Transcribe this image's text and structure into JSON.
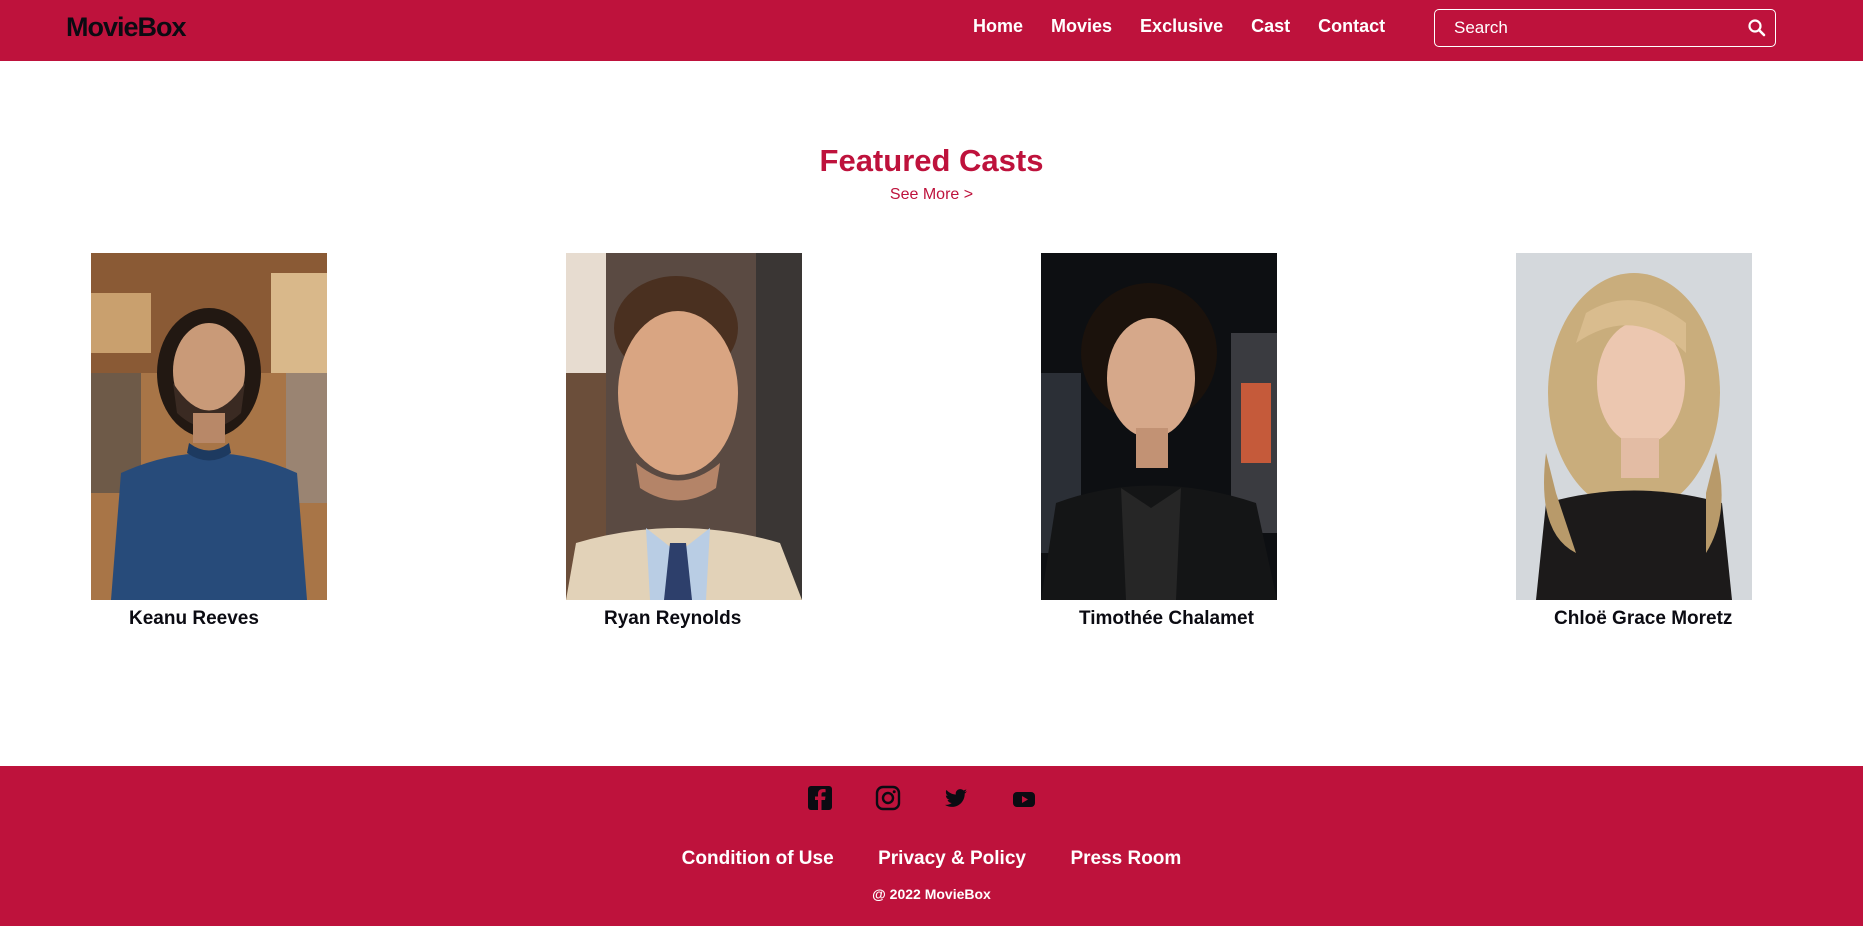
{
  "header": {
    "logo": "MovieBox",
    "nav": [
      "Home",
      "Movies",
      "Exclusive",
      "Cast",
      "Contact"
    ],
    "search_placeholder": "Search"
  },
  "main": {
    "title": "Featured Casts",
    "see_more": "See More >",
    "casts": [
      {
        "name": "Keanu Reeves"
      },
      {
        "name": "Ryan Reynolds"
      },
      {
        "name": "Timothée Chalamet"
      },
      {
        "name": "Chloë Grace Moretz"
      }
    ]
  },
  "footer": {
    "social_icons": [
      "facebook-icon",
      "instagram-icon",
      "twitter-icon",
      "youtube-icon"
    ],
    "links": [
      "Condition of Use",
      "Privacy & Policy",
      "Press Room"
    ],
    "copyright": "@ 2022 MovieBox"
  },
  "colors": {
    "brand": "#be123c",
    "text_dark": "#0b0b12",
    "white": "#ffffff"
  }
}
